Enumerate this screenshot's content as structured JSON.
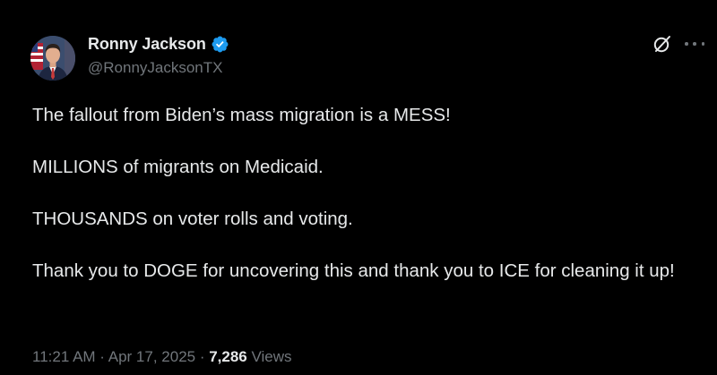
{
  "author": {
    "display_name": "Ronny Jackson",
    "handle": "@RonnyJacksonTX",
    "verified": true,
    "verified_color": "#1d9bf0",
    "avatar_icon": "profile-photo"
  },
  "header_icons": {
    "grok": "grok-icon",
    "more": "more-options-icon"
  },
  "tweet": {
    "paragraphs": [
      "The fallout from Biden’s mass migration is a MESS!",
      "MILLIONS of migrants on Medicaid.",
      "THOUSANDS on voter rolls and voting.",
      "Thank you to DOGE for uncovering this and thank you to ICE for cleaning it up!"
    ]
  },
  "meta": {
    "time": "11:21 AM",
    "separator": " · ",
    "date": "Apr 17, 2025",
    "views_count": "7,286",
    "views_label": "Views"
  },
  "colors": {
    "background": "#000000",
    "primary_text": "#e7e9ea",
    "secondary_text": "#71767b"
  }
}
